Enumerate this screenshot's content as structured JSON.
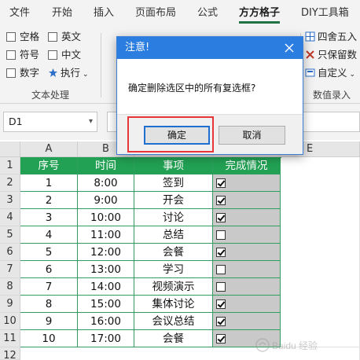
{
  "ribbon": {
    "tabs": [
      "文件",
      "开始",
      "插入",
      "页面布局",
      "公式",
      "方方格子",
      "DIY工具箱"
    ],
    "active_tab": "方方格子",
    "text_processing": {
      "items": [
        "空格",
        "英文",
        "符号",
        "中文",
        "数字",
        "执行"
      ],
      "group_label": "文本处理"
    },
    "numeric_entry": {
      "items": [
        "四舍五入",
        "只保留数",
        "自定义"
      ],
      "group_label": "数值录入"
    },
    "truncated_e": "E"
  },
  "formula_bar": {
    "name_box": "D1",
    "formula": ""
  },
  "sheet": {
    "columns": [
      "A",
      "B",
      "C",
      "D",
      "E"
    ],
    "rows": [
      "1",
      "2",
      "3",
      "4",
      "5",
      "6",
      "7",
      "8",
      "9",
      "10",
      "11",
      "12"
    ],
    "headers": [
      "序号",
      "时间",
      "事项",
      "完成情况"
    ],
    "data": [
      {
        "no": "1",
        "time": "8:00",
        "item": "签到",
        "done": true
      },
      {
        "no": "2",
        "time": "9:00",
        "item": "开会",
        "done": true
      },
      {
        "no": "3",
        "time": "10:00",
        "item": "讨论",
        "done": true
      },
      {
        "no": "4",
        "time": "11:00",
        "item": "总结",
        "done": false
      },
      {
        "no": "5",
        "time": "12:00",
        "item": "会餐",
        "done": true
      },
      {
        "no": "6",
        "time": "13:00",
        "item": "学习",
        "done": false
      },
      {
        "no": "7",
        "time": "14:00",
        "item": "视频演示",
        "done": false
      },
      {
        "no": "8",
        "time": "15:00",
        "item": "集体讨论",
        "done": true
      },
      {
        "no": "9",
        "time": "16:00",
        "item": "会议总结",
        "done": true
      },
      {
        "no": "10",
        "time": "17:00",
        "item": "会餐",
        "done": true
      }
    ]
  },
  "dialog": {
    "title": "注意!",
    "message": "确定删除选区中的所有复选框?",
    "ok_label": "确定",
    "cancel_label": "取消"
  },
  "colors": {
    "accent_green": "#22a154",
    "dialog_title": "#2b7de0",
    "highlight_red": "#e8353a"
  },
  "watermark": "Baidu 经验 jingyan.baidu.com"
}
